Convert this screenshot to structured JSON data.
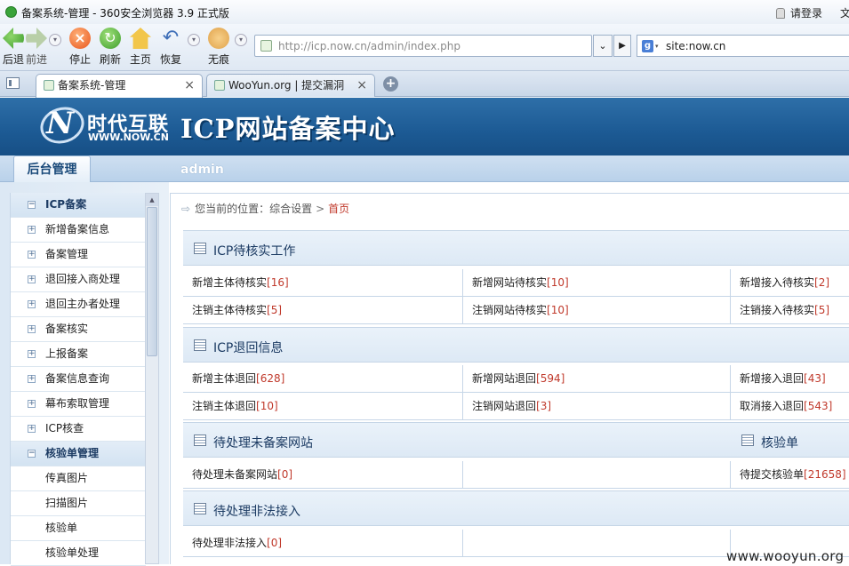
{
  "browser": {
    "title": "备案系统-管理 - 360安全浏览器 3.9 正式版",
    "login": "请登录",
    "file_menu": "文",
    "toolbar": {
      "back": "后退",
      "forward": "前进",
      "stop": "停止",
      "refresh": "刷新",
      "home": "主页",
      "restore": "恢复",
      "incognito": "无痕"
    },
    "address": "http://icp.now.cn/admin/index.php",
    "search": "site:now.cn",
    "tabs": [
      {
        "label": "备案系统-管理",
        "close": "×"
      },
      {
        "label": "WooYun.org | 提交漏洞",
        "close": "×"
      }
    ],
    "new_tab": "+"
  },
  "header": {
    "logo_cn": "时代互联",
    "logo_url": "WWW.NOW.CN",
    "logo_mark": "N",
    "title": "ICP网站备案中心"
  },
  "nav": {
    "tab": "后台管理",
    "user": "admin"
  },
  "sidebar": {
    "items": [
      {
        "label": "ICP备案",
        "type": "group",
        "marker": "−"
      },
      {
        "label": "新增备案信息",
        "type": "item",
        "marker": "+"
      },
      {
        "label": "备案管理",
        "type": "item",
        "marker": "+"
      },
      {
        "label": "退回接入商处理",
        "type": "item",
        "marker": "+"
      },
      {
        "label": "退回主办者处理",
        "type": "item",
        "marker": "+"
      },
      {
        "label": "备案核实",
        "type": "item",
        "marker": "+"
      },
      {
        "label": "上报备案",
        "type": "item",
        "marker": "+"
      },
      {
        "label": "备案信息查询",
        "type": "item",
        "marker": "+"
      },
      {
        "label": "幕布索取管理",
        "type": "item",
        "marker": "+"
      },
      {
        "label": "ICP核查",
        "type": "item",
        "marker": "+"
      },
      {
        "label": "核验单管理",
        "type": "group",
        "marker": "−"
      },
      {
        "label": "传真图片",
        "type": "sub",
        "marker": ""
      },
      {
        "label": "扫描图片",
        "type": "sub",
        "marker": ""
      },
      {
        "label": "核验单",
        "type": "sub",
        "marker": ""
      },
      {
        "label": "核验单处理",
        "type": "sub",
        "marker": ""
      }
    ]
  },
  "breadcrumb": {
    "prefix": "您当前的位置：综合设置",
    "separator": ">",
    "current": "首页"
  },
  "sections": [
    {
      "title": "ICP待核实工作",
      "rows": [
        [
          {
            "label": "新增主体待核实",
            "count": "[16]"
          },
          {
            "label": "新增网站待核实",
            "count": "[10]"
          },
          {
            "label": "新增接入待核实",
            "count": "[2]"
          }
        ],
        [
          {
            "label": "注销主体待核实",
            "count": "[5]"
          },
          {
            "label": "注销网站待核实",
            "count": "[10]"
          },
          {
            "label": "注销接入待核实",
            "count": "[5]"
          }
        ]
      ]
    },
    {
      "title": "ICP退回信息",
      "rows": [
        [
          {
            "label": "新增主体退回",
            "count": "[628]"
          },
          {
            "label": "新增网站退回",
            "count": "[594]"
          },
          {
            "label": "新增接入退回",
            "count": "[43]"
          }
        ],
        [
          {
            "label": "注销主体退回",
            "count": "[10]"
          },
          {
            "label": "注销网站退回",
            "count": "[3]"
          },
          {
            "label": "取消接入退回",
            "count": "[543]"
          }
        ]
      ]
    },
    {
      "title": "待处理未备案网站",
      "title2": "核验单",
      "rows": [
        [
          {
            "label": "待处理未备案网站",
            "count": "[0]"
          },
          {
            "label": "",
            "count": ""
          },
          {
            "label": "待提交核验单",
            "count": "[21658]"
          }
        ]
      ]
    },
    {
      "title": "待处理非法接入",
      "rows": [
        [
          {
            "label": "待处理非法接入",
            "count": "[0]"
          },
          {
            "label": "",
            "count": ""
          },
          {
            "label": "",
            "count": ""
          }
        ]
      ]
    }
  ],
  "watermark": "www.wooyun.org",
  "colors": {
    "header_blue": "#1c5a94",
    "count_red": "#c0392b",
    "section_bg": "#dde9f5"
  }
}
